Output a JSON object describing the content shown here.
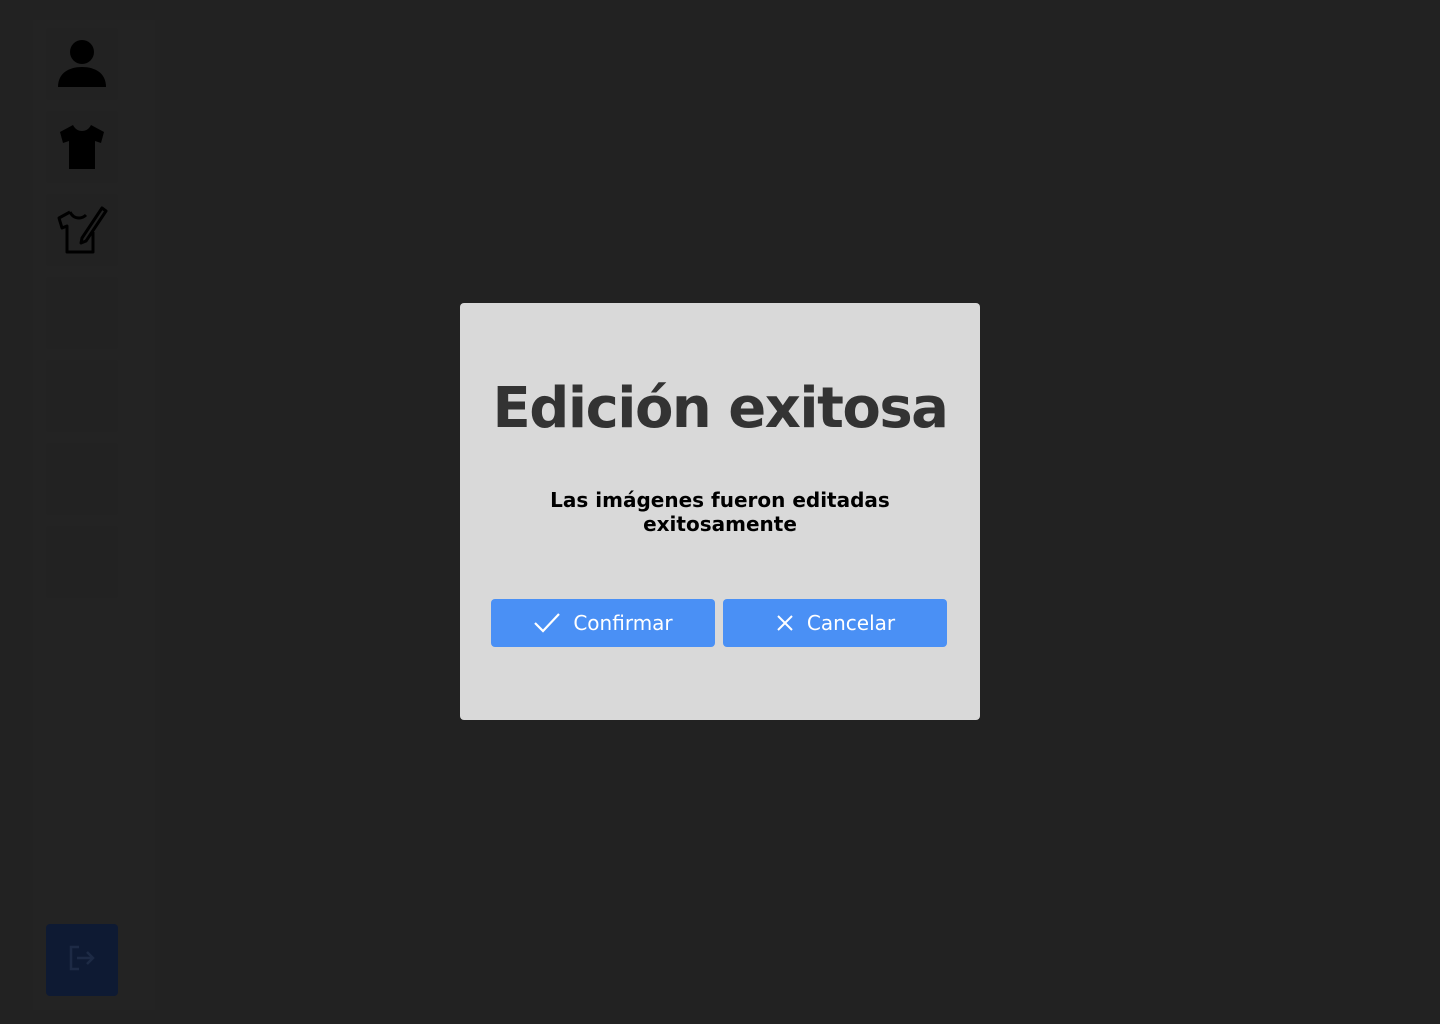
{
  "sidebar": {
    "items": [
      {
        "icon": "user-icon"
      },
      {
        "icon": "tshirt-icon"
      },
      {
        "icon": "tshirt-edit-icon"
      }
    ],
    "logout_icon": "logout-icon"
  },
  "modal": {
    "title": "Edición exitosa",
    "message": "Las imágenes fueron editadas exitosamente",
    "confirm_label": "Confirmar",
    "cancel_label": "Cancelar",
    "confirm_icon": "check-icon",
    "cancel_icon": "close-icon"
  },
  "colors": {
    "background": "#222222",
    "modal_background": "#d9d9d9",
    "button": "#4a90f5",
    "title": "#333333",
    "logout_button": "#0e1a33"
  }
}
